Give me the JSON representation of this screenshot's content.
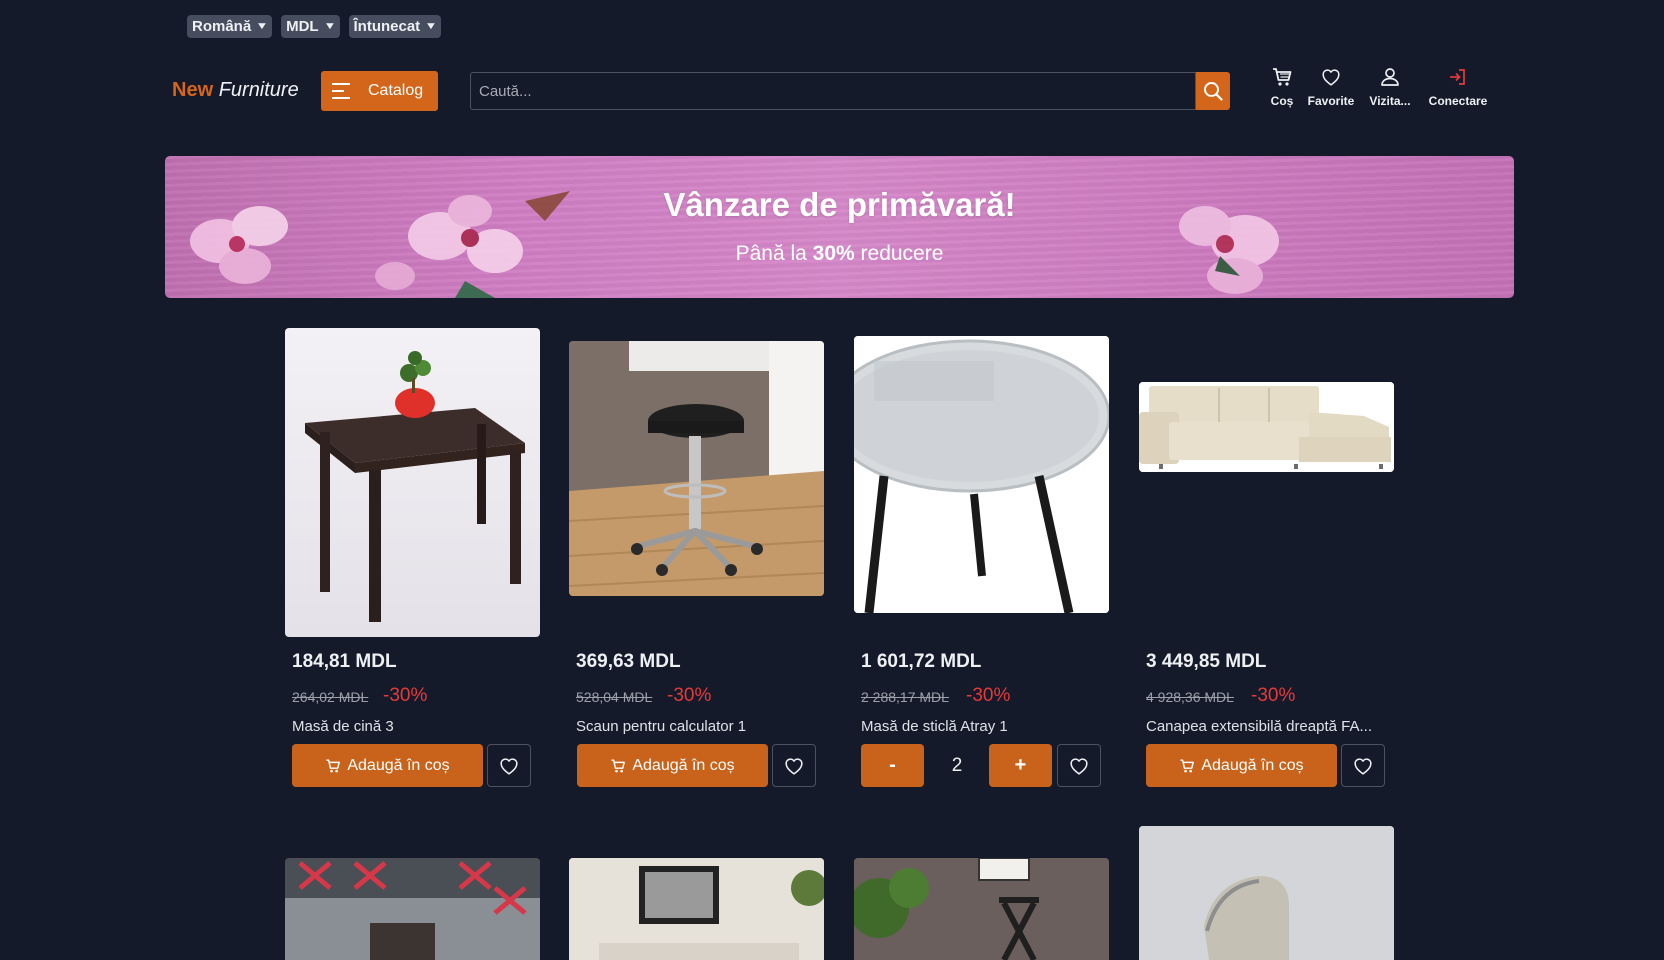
{
  "topbar": {
    "language": "Română",
    "currency": "MDL",
    "theme": "Întunecat"
  },
  "header": {
    "logo_part1": "New",
    "logo_part2": "Furniture",
    "catalog_label": "Catalog",
    "search_placeholder": "Caută...",
    "nav": {
      "cart": "Coș",
      "favorites": "Favorite",
      "visitor": "Vizita...",
      "login": "Conectare"
    }
  },
  "banner": {
    "title": "Vânzare de primăvară!",
    "sub_prefix": "Până la",
    "sub_bold": "30%",
    "sub_suffix": "reducere"
  },
  "products": [
    {
      "price": "184,81 MDL",
      "old_price": "264,02 MDL",
      "discount": "-30%",
      "name": "Masă de cină 3",
      "button": "Adaugă în coș"
    },
    {
      "price": "369,63 MDL",
      "old_price": "528,04 MDL",
      "discount": "-30%",
      "name": "Scaun pentru calculator 1",
      "button": "Adaugă în coș"
    },
    {
      "price": "1 601,72 MDL",
      "old_price": "2 288,17 MDL",
      "discount": "-30%",
      "name": "Masă de sticlă Atray 1",
      "qty_minus": "-",
      "qty": "2",
      "qty_plus": "+"
    },
    {
      "price": "3 449,85 MDL",
      "old_price": "4 928,36 MDL",
      "discount": "-30%",
      "name": "Canapea extensibilă dreaptă FA...",
      "button": "Adaugă în coș"
    }
  ],
  "colors": {
    "background": "#141a29",
    "accent": "#d4661b",
    "discount": "#e53a3a"
  }
}
